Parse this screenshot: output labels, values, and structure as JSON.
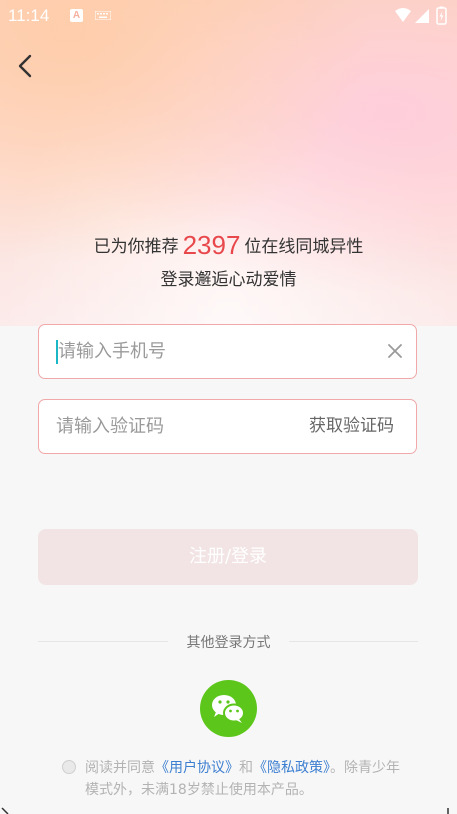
{
  "status_bar": {
    "time": "11:14",
    "icons": [
      "a-notification-icon",
      "keyboard-icon",
      "wifi-icon",
      "signal-icon",
      "battery-icon"
    ]
  },
  "header": {
    "back_icon": "chevron-left-icon"
  },
  "promo": {
    "prefix": "已为你推荐",
    "count": "2397",
    "suffix": "位在线同城异性",
    "tagline": "登录邂逅心动爱情"
  },
  "form": {
    "phone_placeholder": "请输入手机号",
    "code_placeholder": "请输入验证码",
    "get_code_label": "获取验证码",
    "submit_label": "注册/登录"
  },
  "other_login": {
    "title": "其他登录方式",
    "wechat_icon": "wechat-icon"
  },
  "agreement": {
    "part1": "阅读并同意",
    "user_agreement": "《用户协议》",
    "and": "和",
    "privacy_policy": "《隐私政策》",
    "part2": "。除青少年模式外，未满18岁禁止使用本产品。"
  },
  "colors": {
    "accent_red": "#e8484c",
    "field_border": "#f0a8a8",
    "link_blue": "#3c7fd1",
    "wechat_green": "#5cc61b",
    "submit_disabled": "#f2e4e4"
  }
}
